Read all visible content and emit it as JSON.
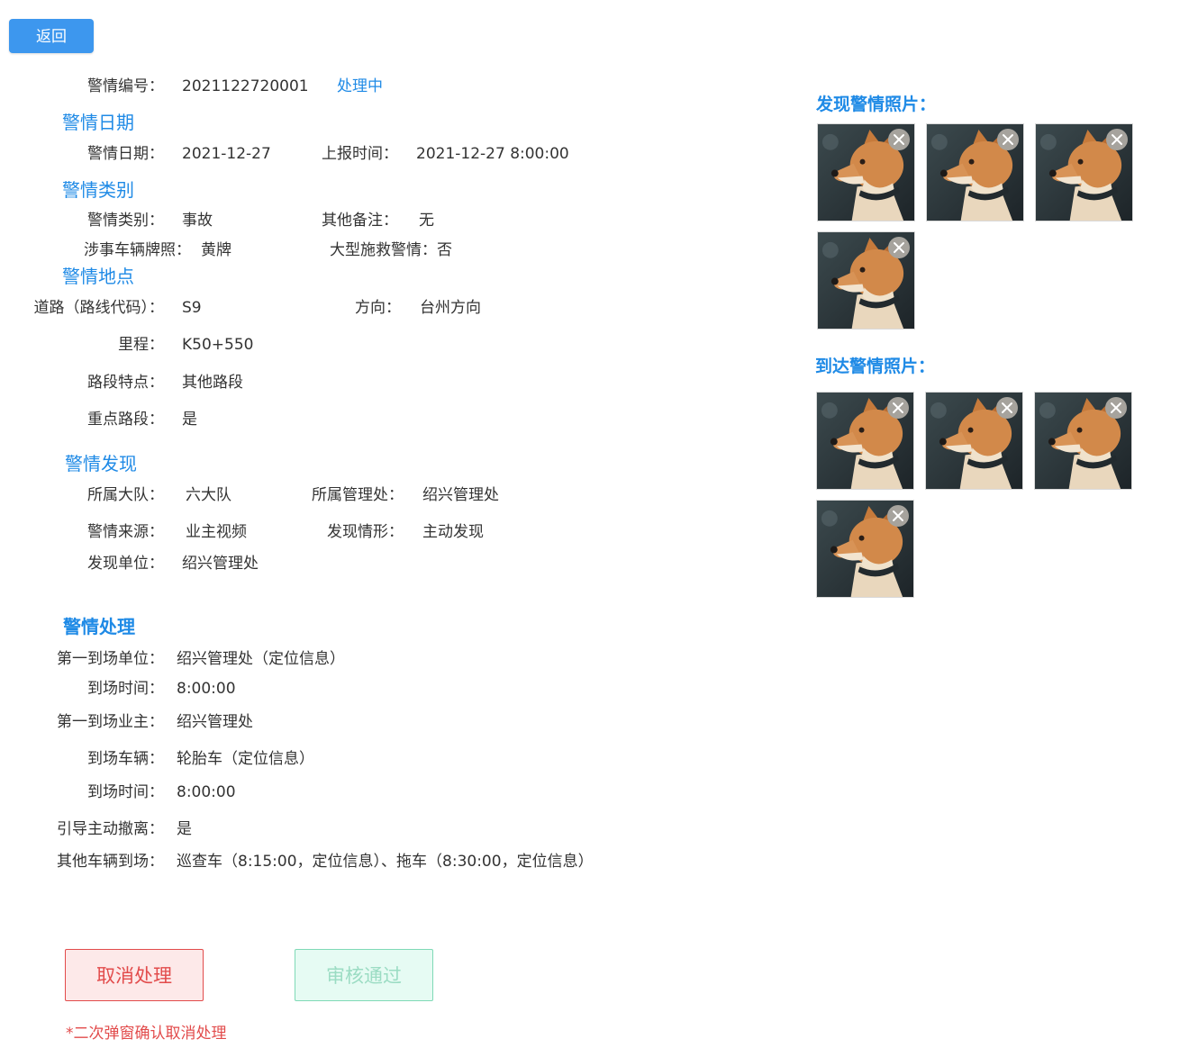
{
  "header": {
    "back_label": "返回"
  },
  "alert": {
    "number_label": "警情编号：",
    "number": "2021122720001",
    "status": "处理中"
  },
  "sections": {
    "date": "警情日期",
    "category": "警情类别",
    "location": "警情地点",
    "discovery": "警情发现",
    "handling": "警情处理"
  },
  "date_info": {
    "date_label": "警情日期：",
    "date": "2021-12-27",
    "report_label": "上报时间：",
    "report_time": "2021-12-27 8:00:00"
  },
  "category_info": {
    "type_label": "警情类别：",
    "type": "事故",
    "remark_label": "其他备注：",
    "remark": "无",
    "plate_label": "涉事车辆牌照：",
    "plate": "黄牌",
    "rescue_label": "大型施救警情：",
    "rescue": "否"
  },
  "location_info": {
    "road_label": "道路（路线代码）：",
    "road": "S9",
    "direction_label": "方向：",
    "direction": "台州方向",
    "mileage_label": "里程：",
    "mileage": "K50+550",
    "segment_label": "路段特点：",
    "segment": "其他路段",
    "key_label": "重点路段：",
    "key": "是"
  },
  "discovery_info": {
    "brigade_label": "所属大队：",
    "brigade": "六大队",
    "office_label": "所属管理处：",
    "office": "绍兴管理处",
    "source_label": "警情来源：",
    "source": "业主视频",
    "situation_label": "发现情形：",
    "situation": "主动发现",
    "unit_label": "发现单位：",
    "unit": "绍兴管理处"
  },
  "handling_info": {
    "first_unit_label": "第一到场单位：",
    "first_unit": "绍兴管理处（定位信息）",
    "arrive_time1_label": "到场时间：",
    "arrive_time1": "8:00:00",
    "first_owner_label": "第一到场业主：",
    "first_owner": "绍兴管理处",
    "vehicle_label": "到场车辆：",
    "vehicle": "轮胎车（定位信息）",
    "arrive_time2_label": "到场时间：",
    "arrive_time2": "8:00:00",
    "guide_label": "引导主动撤离：",
    "guide": "是",
    "other_label": "其他车辆到场：",
    "other": "巡查车（8:15:00，定位信息）、拖车（8:30:00，定位信息）"
  },
  "actions": {
    "cancel_label": "取消处理",
    "approve_label": "审核通过",
    "note": "*二次弹窗确认取消处理"
  },
  "photos": {
    "found_title": "发现警情照片：",
    "arrive_title": "到达警情照片：",
    "found_count": 4,
    "arrive_count": 4,
    "thumb_icon": "shiba-dog-photo",
    "remove_icon": "close-circle-icon"
  },
  "colors": {
    "accent": "#1f8ae6",
    "back_button": "#3d97ee",
    "danger": "#e24b4b",
    "success_border": "#7fd9b6"
  }
}
